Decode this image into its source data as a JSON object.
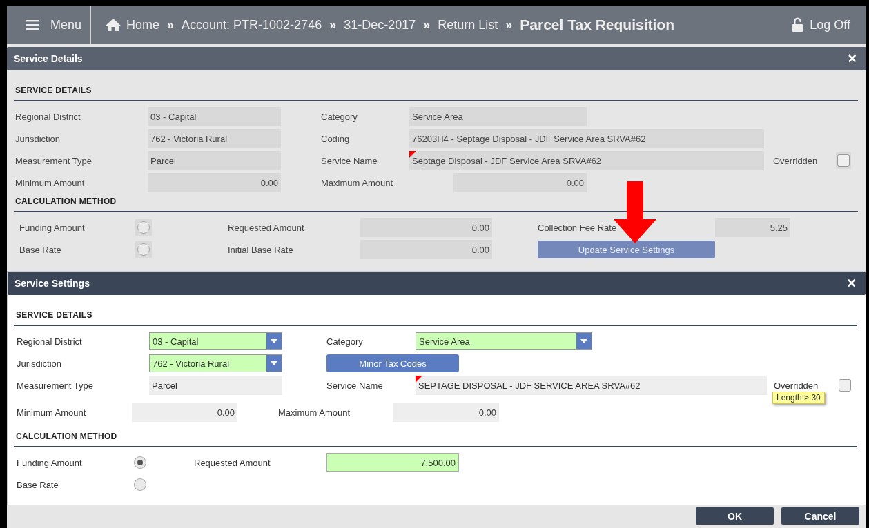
{
  "nav": {
    "menu": "Menu",
    "crumbs": [
      {
        "kind": "home",
        "label": "Home"
      },
      {
        "kind": "sep",
        "label": "»"
      },
      {
        "kind": "link",
        "label": "Account: PTR-1002-2746"
      },
      {
        "kind": "sep",
        "label": "»"
      },
      {
        "kind": "link",
        "label": "31-Dec-2017"
      },
      {
        "kind": "sep",
        "label": "»"
      },
      {
        "kind": "link",
        "label": "Return List"
      },
      {
        "kind": "sep",
        "label": "»"
      },
      {
        "kind": "current",
        "label": "Parcel Tax Requisition"
      }
    ],
    "logoff": "Log Off"
  },
  "panels": [
    {
      "title": "Service Details",
      "close": "×",
      "sections": [
        {
          "title": "SERVICE DETAILS",
          "rows": [
            [
              {
                "kind": "label",
                "text": "Regional District"
              },
              {
                "kind": "field",
                "text": "03 - Capital"
              },
              {
                "kind": "label",
                "text": "Category"
              },
              {
                "kind": "field",
                "text": "Service Area"
              }
            ],
            [
              {
                "kind": "label",
                "text": "Jurisdiction"
              },
              {
                "kind": "field",
                "text": "762 - Victoria Rural"
              },
              {
                "kind": "label",
                "text": "Coding"
              },
              {
                "kind": "field",
                "text": "76203H4 - Septage Disposal - JDF Service Area SRVA#62"
              }
            ],
            [
              {
                "kind": "label",
                "text": "Measurement Type"
              },
              {
                "kind": "field",
                "text": "Parcel"
              },
              {
                "kind": "label",
                "text": "Service Name"
              },
              {
                "kind": "field",
                "text": "Septage Disposal - JDF Service Area SRVA#62",
                "flagged": true
              },
              {
                "kind": "label",
                "text": "Overridden"
              },
              {
                "kind": "checkbox",
                "checked": false
              }
            ],
            [
              {
                "kind": "label",
                "text": "Minimum Amount"
              },
              {
                "kind": "amount",
                "text": "0.00"
              },
              {
                "kind": "label",
                "text": "Maximum Amount"
              },
              {
                "kind": "amount",
                "text": "0.00"
              }
            ]
          ]
        },
        {
          "title": "CALCULATION METHOD",
          "rows": [
            [
              {
                "kind": "label",
                "text": "Funding Amount"
              },
              {
                "kind": "radio",
                "selected": false
              },
              {
                "kind": "label",
                "text": "Requested Amount"
              },
              {
                "kind": "amount",
                "text": "0.00"
              },
              {
                "kind": "label",
                "text": "Collection Fee Rate"
              },
              {
                "kind": "amount",
                "text": "5.25"
              }
            ],
            [
              {
                "kind": "label",
                "text": "Base Rate"
              },
              {
                "kind": "radio",
                "selected": false
              },
              {
                "kind": "label",
                "text": "Initial Base Rate"
              },
              {
                "kind": "amount",
                "text": "0.00"
              },
              {
                "kind": "button",
                "text": "Update Service Settings"
              }
            ]
          ]
        }
      ]
    },
    {
      "title": "Service Settings",
      "close": "×",
      "sections": [
        {
          "title": "SERVICE DETAILS",
          "rows": [
            [
              {
                "kind": "label",
                "text": "Regional District"
              },
              {
                "kind": "select",
                "text": "03 - Capital"
              },
              {
                "kind": "label",
                "text": "Category"
              },
              {
                "kind": "select",
                "text": "Service Area"
              }
            ],
            [
              {
                "kind": "label",
                "text": "Jurisdiction"
              },
              {
                "kind": "select",
                "text": "762 - Victoria Rural"
              },
              {
                "kind": "button",
                "text": "Minor Tax Codes"
              }
            ],
            [
              {
                "kind": "label",
                "text": "Measurement Type"
              },
              {
                "kind": "field",
                "text": "Parcel"
              },
              {
                "kind": "label",
                "text": "Service Name"
              },
              {
                "kind": "field",
                "text": "SEPTAGE DISPOSAL - JDF SERVICE AREA SRVA#62",
                "flagged": true
              },
              {
                "kind": "label",
                "text": "Overridden",
                "tooltip": "Length > 30"
              },
              {
                "kind": "checkbox",
                "checked": false
              }
            ],
            [
              {
                "kind": "label",
                "text": "Minimum Amount"
              },
              {
                "kind": "amount",
                "text": "0.00"
              },
              {
                "kind": "label",
                "text": "Maximum Amount"
              },
              {
                "kind": "amount",
                "text": "0.00"
              }
            ]
          ]
        },
        {
          "title": "CALCULATION METHOD",
          "rows": [
            [
              {
                "kind": "label",
                "text": "Funding Amount"
              },
              {
                "kind": "radio",
                "selected": true
              },
              {
                "kind": "label",
                "text": "Requested Amount"
              },
              {
                "kind": "input",
                "text": "7,500.00"
              }
            ],
            [
              {
                "kind": "label",
                "text": "Base Rate"
              },
              {
                "kind": "radio",
                "selected": false
              }
            ]
          ]
        }
      ],
      "buttons": [
        "OK",
        "Cancel"
      ]
    }
  ]
}
